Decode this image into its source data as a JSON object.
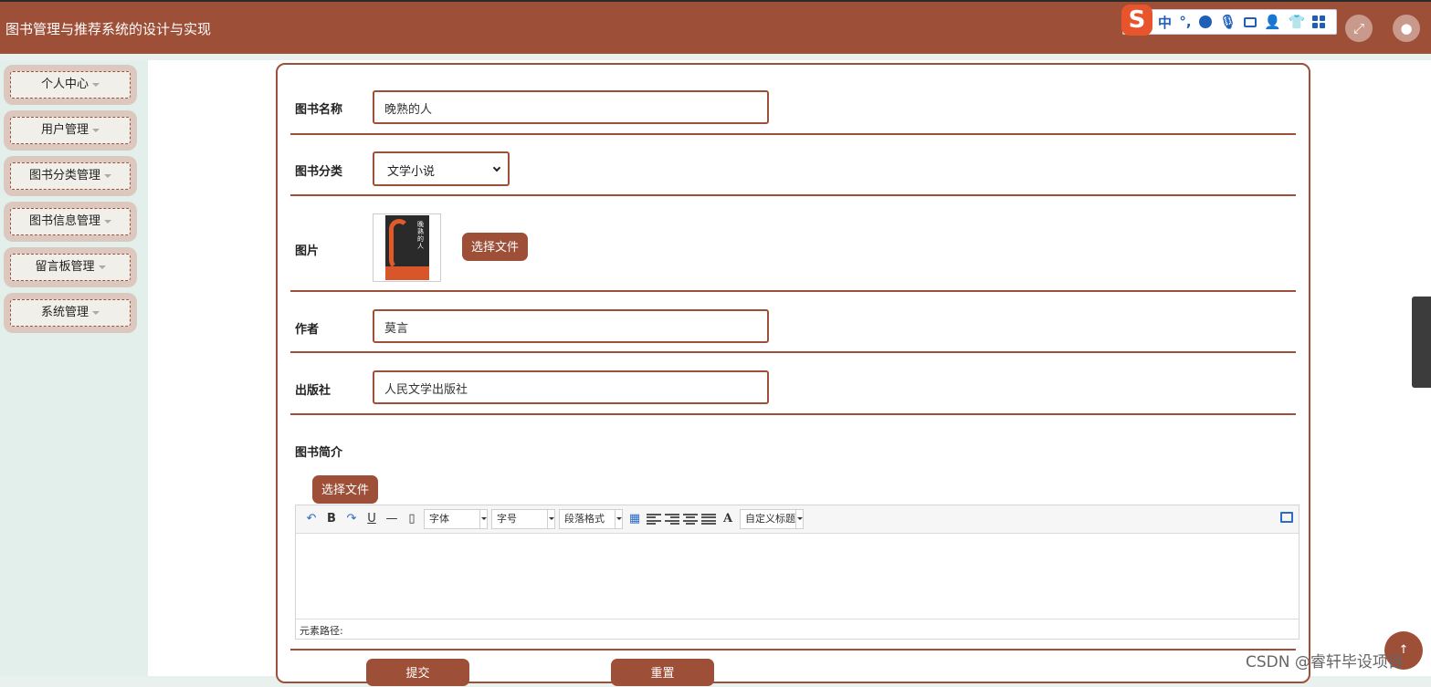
{
  "header": {
    "title": "图书管理与推荐系统的设计与实现",
    "ime": {
      "logo": "S",
      "lang": "中",
      "punct": "°,"
    },
    "fullscreen_icon": "expand-icon",
    "avatar_icon": "user-icon"
  },
  "sidebar": {
    "items": [
      {
        "label": "个人中心"
      },
      {
        "label": "用户管理"
      },
      {
        "label": "图书分类管理"
      },
      {
        "label": "图书信息管理"
      },
      {
        "label": "留言板管理"
      },
      {
        "label": "系统管理"
      }
    ]
  },
  "form": {
    "name": {
      "label": "图书名称",
      "value": "晚熟的人"
    },
    "category": {
      "label": "图书分类",
      "value": "文学小说"
    },
    "image": {
      "label": "图片",
      "button": "选择文件",
      "cover_text": "晚熟的人"
    },
    "author": {
      "label": "作者",
      "value": "莫言"
    },
    "publisher": {
      "label": "出版社",
      "value": "人民文学出版社"
    },
    "intro": {
      "label": "图书简介",
      "upload_button": "选择文件"
    },
    "editor": {
      "toolbar": {
        "undo": "↶",
        "bold": "B",
        "redo": "↷",
        "underline": "U",
        "hr": "—",
        "font_family": "字体",
        "font_size": "字号",
        "paragraph": "段落格式",
        "text_color": "A",
        "custom_title": "自定义标题"
      },
      "footer": "元素路径:"
    },
    "submit": "提交",
    "reset": "重置"
  },
  "floating": {
    "label": "↑"
  },
  "watermark": "CSDN @睿轩毕设项目",
  "colors": {
    "primary": "#9e4f37",
    "sidebar_bg": "#e3efea",
    "nav_pill": "#dcc8bf"
  }
}
